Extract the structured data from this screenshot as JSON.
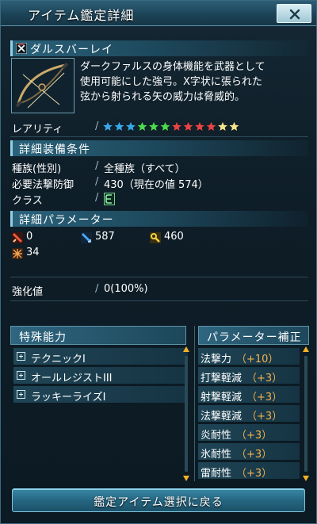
{
  "window": {
    "title": "アイテム鑑定詳細",
    "close_label": "✕"
  },
  "item": {
    "name": "ダルスバーレイ",
    "description_lines": [
      "ダークファルスの身体機能を武器として",
      "使用可能にした強弓。X字状に張られた",
      "弦から射られる矢の威力は脅威的。"
    ],
    "rarity_label": "レアリティ",
    "rarity_stars": 12,
    "star_colors": [
      "#38a8e8",
      "#38a8e8",
      "#38a8e8",
      "#4dd94d",
      "#4dd94d",
      "#4dd94d",
      "#e84444",
      "#e84444",
      "#e84444",
      "#e84444",
      "#f2e48a",
      "#f2e48a"
    ]
  },
  "equip_section": {
    "title": "詳細装備条件",
    "race_label": "種族(性別)",
    "race_value": "全種族（すべて）",
    "defense_label": "必要法撃防御",
    "defense_value": "430（現在の値 574）",
    "class_label": "クラス",
    "class_icon": "ranger-class-icon",
    "separator": "/"
  },
  "param_section": {
    "title": "詳細パラメーター",
    "params": [
      {
        "icon": "striking-attack-icon",
        "value": "0"
      },
      {
        "icon": "ranged-attack-icon",
        "value": "587"
      },
      {
        "icon": "technique-attack-icon",
        "value": "460"
      },
      {
        "icon": "element-icon",
        "value": "34"
      }
    ]
  },
  "grind": {
    "label": "強化値",
    "value": "0(100%)"
  },
  "special_abilities": {
    "title": "特殊能力",
    "items": [
      "テクニックI",
      "オールレジストIII",
      "ラッキーライズI"
    ]
  },
  "param_bonus": {
    "title": "パラメーター補正",
    "items": [
      {
        "name": "法撃力",
        "value": "（+10）"
      },
      {
        "name": "打撃軽減",
        "value": "（+3）"
      },
      {
        "name": "射撃軽減",
        "value": "（+3）"
      },
      {
        "name": "法撃軽減",
        "value": "（+3）"
      },
      {
        "name": "炎耐性",
        "value": "（+3）"
      },
      {
        "name": "氷耐性",
        "value": "（+3）"
      },
      {
        "name": "雷耐性",
        "value": "（+3）"
      }
    ]
  },
  "footer": {
    "back_button": "鑑定アイテム選択に戻る"
  }
}
